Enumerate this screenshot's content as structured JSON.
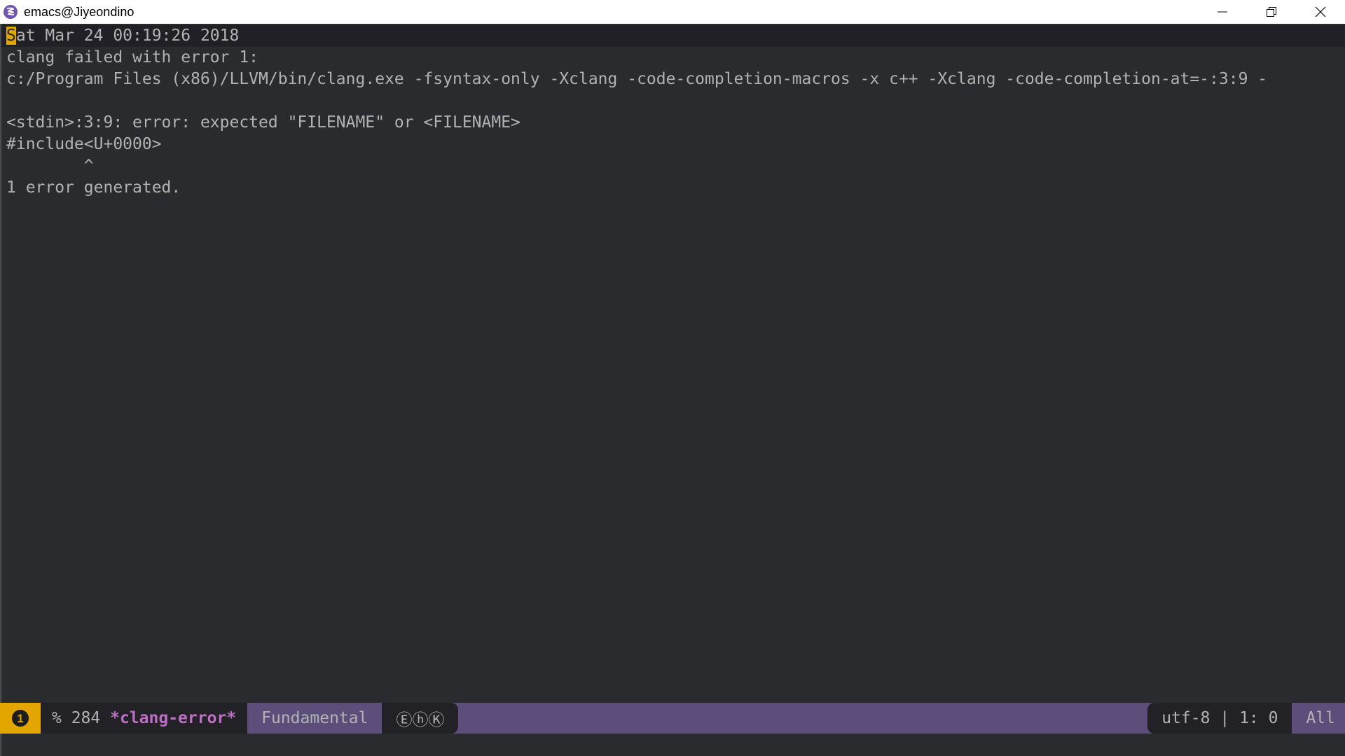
{
  "window": {
    "title": "emacs@Jiyeondino",
    "icon": "emacs-icon",
    "controls": [
      "minimize-icon",
      "restore-icon",
      "close-icon"
    ]
  },
  "buffer": {
    "cursor_char": "S",
    "lines": [
      "at Mar 24 00:19:26 2018",
      "clang failed with error 1:",
      "c:/Program Files (x86)/LLVM/bin/clang.exe -fsyntax-only -Xclang -code-completion-macros -x c++ -Xclang -code-completion-at=-:3:9 -",
      "",
      "<stdin>:3:9: error: expected \"FILENAME\" or <FILENAME>",
      "#include<U+0000>",
      "        ^",
      "1 error generated."
    ]
  },
  "modeline": {
    "window_number": "1",
    "modified_flag": "%",
    "buffer_size": "284",
    "buffer_name": "*clang-error*",
    "major_mode": "Fundamental",
    "minor_modes": "ⒺⓗⓀ",
    "encoding": "utf-8",
    "separator": "|",
    "position": "1: 0",
    "scroll": "All"
  },
  "colors": {
    "background": "#292b2e",
    "text": "#b2b2b2",
    "cursor": "#e3a600",
    "modeline_purple": "#5d4d7a",
    "buffer_name": "#bc6ec5"
  }
}
